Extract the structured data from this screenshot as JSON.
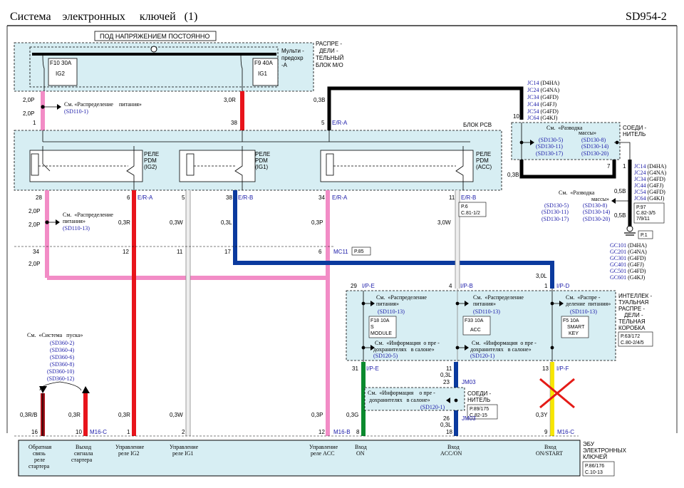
{
  "header": {
    "title": "Система    электронных     ключей   (1)",
    "code": "SD954-2"
  },
  "top_label": "ПОД НАПРЯЖЕНИЕМ ПОСТОЯННО",
  "fuse_block": {
    "fuse1_a": "F10 30A",
    "fuse1_b": "IG2",
    "fuse2_a": "F9 40A",
    "fuse2_b": "IG1",
    "multi_1": "Мульти -",
    "multi_2": "предохр",
    "multi_3": "-А",
    "name_1": "РАСПРЕ -",
    "name_2": "ДЕЛИ -",
    "name_3": "ТЕЛЬНЫЙ",
    "name_4": "БЛОК  М/О"
  },
  "power_ref": {
    "see": "См. «Распределение    питания»",
    "code": "(SD110-1)"
  },
  "wires": {
    "w2p_a": "2,0P",
    "w2p_b": "2,0P",
    "w3r": "3,0R",
    "w03b": "0,3B",
    "w03b_b": "0,3B",
    "w2p_c": "2,0P",
    "w2p_d": "2,0P",
    "w2p_e": "2,0P",
    "w03r": "0,3R",
    "w03w": "0,3W",
    "w03l": "0,3L",
    "w03p": "0,3P",
    "w30w": "3,0W",
    "w30l": "3,0L",
    "w05b_a": "0,5B",
    "w05b_b": "0,5B",
    "w03l_b": "0,3L",
    "w03l_c": "0,3L",
    "w03g": "0,3G",
    "w03y": "0,3Y",
    "w03rb": "0,3R/B",
    "w03r2": "0,3R",
    "w03r3": "0,3R",
    "w03w2": "0,3W",
    "w03p2": "0,3P"
  },
  "pins": {
    "p1": "1",
    "p38": "38",
    "p5": "5",
    "p28": "28",
    "p6": "6",
    "p5b": "5",
    "p38b": "38",
    "p34": "34",
    "p11": "11",
    "p10": "10",
    "p7": "7",
    "p1b": "1",
    "p34b": "34",
    "p12": "12",
    "p11b": "11",
    "p17": "17",
    "p6b": "6",
    "p29": "29",
    "p4": "4",
    "p1c": "1",
    "p31": "31",
    "p23": "23",
    "p13": "13",
    "p11c": "11",
    "p26": "26",
    "p16": "16",
    "p10b": "10",
    "p1d": "1",
    "p2": "2",
    "p12b": "12",
    "p8": "8",
    "p18": "18",
    "p9": "9"
  },
  "connectors": {
    "era": "E/R-A",
    "era2": "E/R-A",
    "erb": "E/R-B",
    "era3": "E/R-A",
    "erb2": "E/R-B",
    "mc11": "MC11",
    "ipe": "I/P-E",
    "ipb": "I/P-B",
    "ipd": "I/P-D",
    "ipe2": "I/P-E",
    "ipf": "I/P-F",
    "jm03": "JM03",
    "jm03b": "JM03",
    "m16c": "M16-C",
    "m16b": "M16-B",
    "m16c2": "M16-C"
  },
  "pcb": {
    "label": "БЛОК PCB"
  },
  "relays": {
    "r1": [
      "РЕЛЕ",
      "PDM",
      "(IG2)"
    ],
    "r2": [
      "РЕЛЕ",
      "PDM",
      "(IG1)"
    ],
    "r3": [
      "РЕЛЕ",
      "PDM",
      "(ACC)"
    ]
  },
  "ground_ref": {
    "see_1": "См.  «Разводка",
    "see_2": "массы»",
    "codes": [
      "(SD130-5)",
      "(SD130-8)",
      "(SD130-11)",
      "(SD130-14)",
      "(SD130-17)",
      "(SD130-20)"
    ]
  },
  "soedi": [
    "СОЕДИ -",
    "НИТЕЛЬ"
  ],
  "jc_top": [
    [
      "JC14",
      "(D4HA)"
    ],
    [
      "JC24",
      "(G4NA)"
    ],
    [
      "JC34",
      "(G4FD)"
    ],
    [
      "JC44",
      "(G4FJ)"
    ],
    [
      "JC54",
      "(G4FD)"
    ],
    [
      "JC64",
      "(G4KJ)"
    ]
  ],
  "jc_right": [
    [
      "JC14",
      "(D4HA)"
    ],
    [
      "JC24",
      "(G4NA)"
    ],
    [
      "JC34",
      "(G4FD)"
    ],
    [
      "JC44",
      "(G4FJ)"
    ],
    [
      "JC54",
      "(G4FD)"
    ],
    [
      "JC64",
      "(G4KJ)"
    ]
  ],
  "gc_right": [
    [
      "GC101",
      "(D4HA)"
    ],
    [
      "GC201",
      "(G4NA)"
    ],
    [
      "GC301",
      "(G4FD)"
    ],
    [
      "GC401",
      "(G4FJ)"
    ],
    [
      "GC501",
      "(G4FD)"
    ],
    [
      "GC601",
      "(G4KJ)"
    ]
  ],
  "ground_ref2": {
    "see_1": "См.  «Разводка",
    "see_2": "массы»",
    "codes": [
      "(SD130-5)",
      "(SD130-8)",
      "(SD130-11)",
      "(SD130-14)",
      "(SD130-17)",
      "(SD130-20)"
    ]
  },
  "pages": {
    "p6": "P.6",
    "c81": "C.81-1/2",
    "p85": "P.85",
    "p97": "P.97",
    "c82": "C.82-3/5",
    "c711": "7/9/11",
    "p1": "P.1",
    "p63": "P.63/172",
    "c80": "C.80-2/4/5",
    "p89": "P.89/175",
    "c8215": "C.82-15",
    "p86": "P.86/176",
    "c1013": "C.10-13"
  },
  "power_ref2": {
    "see_1": "См.  «Распределение",
    "see_2": "питания»",
    "code": "(SD110-13)"
  },
  "smart_box": {
    "name": [
      "ИНТЕЛЛЕК -",
      "ТУАЛЬНАЯ",
      "РАСПРЕ -",
      "ДЕЛИ -",
      "ТЕЛЬНАЯ",
      "КОРОБКА"
    ],
    "col1_see": [
      "См.  «Распределение",
      "питания»"
    ],
    "col1_code": "(SD110-13)",
    "col2_see": [
      "См.  «Распределение",
      "питания»"
    ],
    "col2_code": "(SD110-13)",
    "col3_see": [
      "См.  «Распре -",
      "деление  питания»"
    ],
    "col3_code": "(SD110-13)",
    "f1": [
      "F18 10A",
      "S",
      "MODULE"
    ],
    "f2": [
      "F33 10A",
      "ACC"
    ],
    "f3": [
      "F5 10A",
      "SMART",
      "KEY"
    ],
    "info1": [
      "См.  «Информация  о пре -",
      "дохранителях   в салоне»"
    ],
    "info1_code": "(SD120-5)",
    "info2": [
      "См.  «Информация  о пре -",
      "дохранителях   в салоне»"
    ],
    "info2_code": "(SD120-1)"
  },
  "soedi2": [
    "СОЕДИ -",
    "НИТЕЛЬ"
  ],
  "info3": {
    "see": [
      "См.  «Информация    о пре -",
      "дохранителях   в салоне»"
    ],
    "code": "(SD120-1)"
  },
  "start_ref": {
    "see": "См.  «Система   пуска»",
    "codes": [
      "(SD360-2)",
      "(SD360-4)",
      "(SD360-6)",
      "(SD360-8)",
      "(SD360-10)",
      "(SD360-12)"
    ]
  },
  "ecu": {
    "name": [
      "ЭБУ",
      "ЭЛЕКТРОННЫХ",
      "КЛЮЧЕЙ"
    ],
    "pins": [
      [
        "Обратная",
        "связь",
        "реле",
        "стартера"
      ],
      [
        "Выход",
        "сигнала",
        "стартера"
      ],
      [
        "Управление",
        "реле IG2"
      ],
      [
        "Управление",
        "реле IG1"
      ],
      [
        "Управление",
        "реле ACC"
      ],
      [
        "Вход",
        "ON"
      ],
      [
        "Вход",
        "ACC/ON"
      ],
      [
        "Вход",
        "ON/START"
      ]
    ]
  },
  "colors": {
    "pink": "#f28cc6",
    "red": "#e8141b",
    "blue": "#0b3a9e",
    "black": "#000000",
    "green": "#0a8a2e",
    "yellow": "#f7e600",
    "box": "#d7eef3",
    "cross": "#e41b17"
  }
}
